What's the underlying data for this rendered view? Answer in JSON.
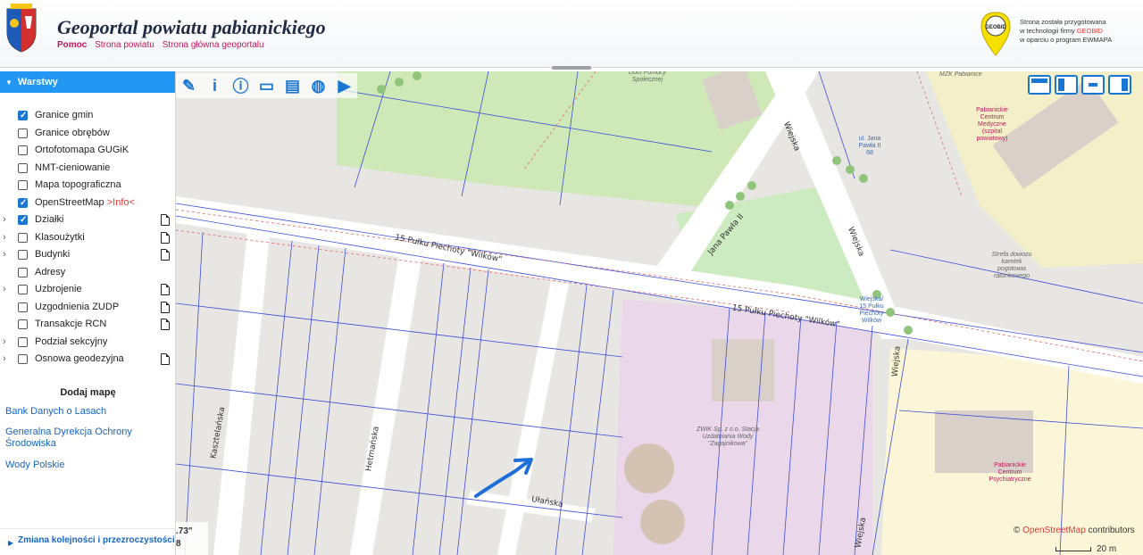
{
  "header": {
    "title": "Geoportal powiatu pabianickiego",
    "links": [
      "Pomoc",
      "Strona powiatu",
      "Strona główna geoportalu"
    ],
    "geobid_logo_text": "GEOBID",
    "geobid_line1": "Strona została przygotowana",
    "geobid_line2_prefix": "w technologii firmy ",
    "geobid_line2_brand": "GEOBID",
    "geobid_line3": "w oparciu o program EWMAPA"
  },
  "sidebar": {
    "panel_title": "Warstwy",
    "layers": [
      {
        "label": "Granice gmin",
        "checked": true,
        "expandable": false,
        "doc": false
      },
      {
        "label": "Granice obrębów",
        "checked": false,
        "expandable": false,
        "doc": false
      },
      {
        "label": "Ortofotomapa GUGiK",
        "checked": false,
        "expandable": false,
        "doc": false
      },
      {
        "label": "NMT-cieniowanie",
        "checked": false,
        "expandable": false,
        "doc": false
      },
      {
        "label": "Mapa topograficzna",
        "checked": false,
        "expandable": false,
        "doc": false
      },
      {
        "label": "OpenStreetMap ",
        "info": ">Info<",
        "checked": true,
        "expandable": false,
        "doc": false
      },
      {
        "label": "Działki",
        "checked": true,
        "expandable": true,
        "doc": true
      },
      {
        "label": "Klasoużytki",
        "checked": false,
        "expandable": true,
        "doc": true
      },
      {
        "label": "Budynki",
        "checked": false,
        "expandable": true,
        "doc": true
      },
      {
        "label": "Adresy",
        "checked": false,
        "expandable": false,
        "doc": false
      },
      {
        "label": "Uzbrojenie",
        "checked": false,
        "expandable": true,
        "doc": true
      },
      {
        "label": "Uzgodnienia ZUDP",
        "checked": false,
        "expandable": false,
        "doc": true
      },
      {
        "label": "Transakcje RCN",
        "checked": false,
        "expandable": false,
        "doc": true
      },
      {
        "label": "Podział sekcyjny",
        "checked": false,
        "expandable": true,
        "doc": false
      },
      {
        "label": "Osnowa geodezyjna",
        "checked": false,
        "expandable": true,
        "doc": true
      }
    ],
    "add_map_title": "Dodaj mapę",
    "map_links": [
      "Bank Danych o Lasach",
      "Generalna Dyrekcja Ochrony Środowiska",
      "Wody Polskie"
    ],
    "bottom_link": "Zmiana kolejności i przezroczystości"
  },
  "map": {
    "tools": [
      "ruler-icon",
      "info-icon",
      "identify-icon",
      "measure-icon",
      "print-icon",
      "globe-icon",
      "video-icon"
    ],
    "coord_line1": ".73\"",
    "coord_line2": "8",
    "attribution_prefix": "© ",
    "attribution_link": "OpenStreetMap",
    "attribution_suffix": " contributors",
    "scale_label": "20 m",
    "streets": {
      "s1": "15 Pułku Piechoty \"Wilków\"",
      "s2": "15 Pułku Piechoty \"Wilków\"",
      "s3": "Jana Pawła II",
      "s4": "Wiejska",
      "s5": "Wiejska",
      "s6": "Kasztelańska",
      "s7": "Hetmańska",
      "s8": "Ułańska",
      "s9": "Wiejska",
      "s10": "Wiejska"
    },
    "pois": {
      "dom": "Dom Pomocy Społecznej",
      "mzk": "MZK Pabianice",
      "centrum_med": "Pabianickie Centrum Medyczne (szpital powiatowy)",
      "bus1": "ul. Jana Pawła II 68",
      "bus2": "Wiejska/ 15 Pułku Piechoty Wilków",
      "strefa": "Strefa dowozu karetek pogotowia ratunkowego",
      "zwik": "ZWiK Sp. z o.o. Stacja Uzdatniania Wody \"Zagajnikowa\"",
      "centrum_psych": "Pabianickie Centrum Psychiatryczne"
    }
  }
}
